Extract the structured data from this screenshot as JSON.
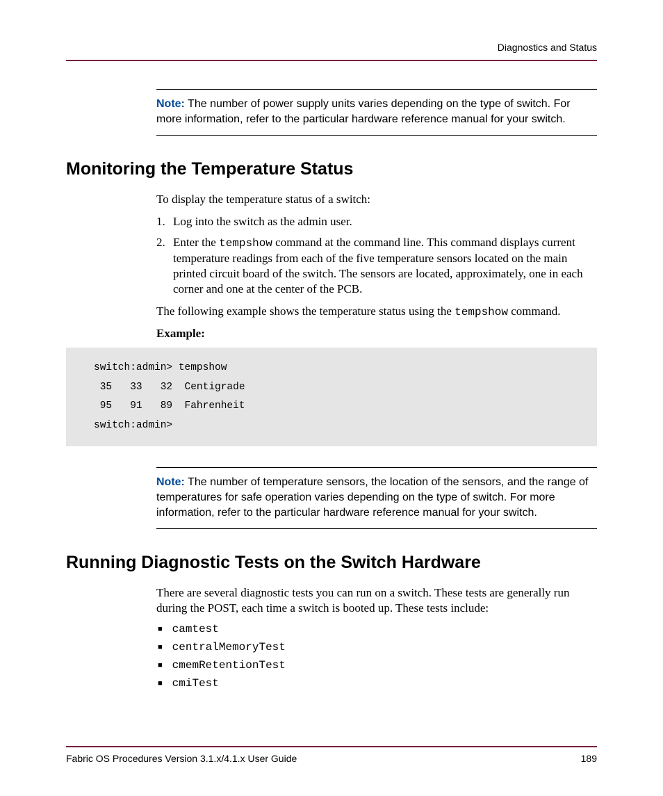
{
  "header": {
    "chapter": "Diagnostics and Status"
  },
  "note1": {
    "label": "Note:",
    "text": "The number of power supply units varies depending on the type of switch. For more information, refer to the particular hardware reference manual for your switch."
  },
  "section_temp": {
    "title": "Monitoring the Temperature Status",
    "intro": "To display the temperature status of a switch:",
    "step1": "Log into the switch as the admin user.",
    "step2_a": "Enter the ",
    "step2_cmd": "tempshow",
    "step2_b": " command at the command line. This command displays current temperature readings from each of the five temperature sensors located on the main printed circuit board of the switch. The sensors are located, approximately, one in each corner and one at the center of the PCB.",
    "follow_a": "The following example shows the temperature status using the  ",
    "follow_cmd": "tempshow",
    "follow_b": " command.",
    "example_label": "Example:",
    "code": "switch:admin> tempshow\n 35   33   32  Centigrade\n 95   91   89  Fahrenheit\nswitch:admin>"
  },
  "note2": {
    "label": "Note:",
    "text": "The number of temperature sensors, the location of the sensors, and the range of temperatures for safe operation varies depending on the type of switch. For more information, refer to the particular hardware reference manual for your switch."
  },
  "section_diag": {
    "title": "Running Diagnostic Tests on the Switch Hardware",
    "intro": "There are several diagnostic tests you can run on a switch. These tests are generally run during the POST, each time a switch is booted up. These tests include:",
    "tests": [
      "camtest",
      "centralMemoryTest",
      "cmemRetentionTest",
      "cmiTest"
    ]
  },
  "footer": {
    "guide": "Fabric OS Procedures Version 3.1.x/4.1.x User Guide",
    "page": "189"
  }
}
